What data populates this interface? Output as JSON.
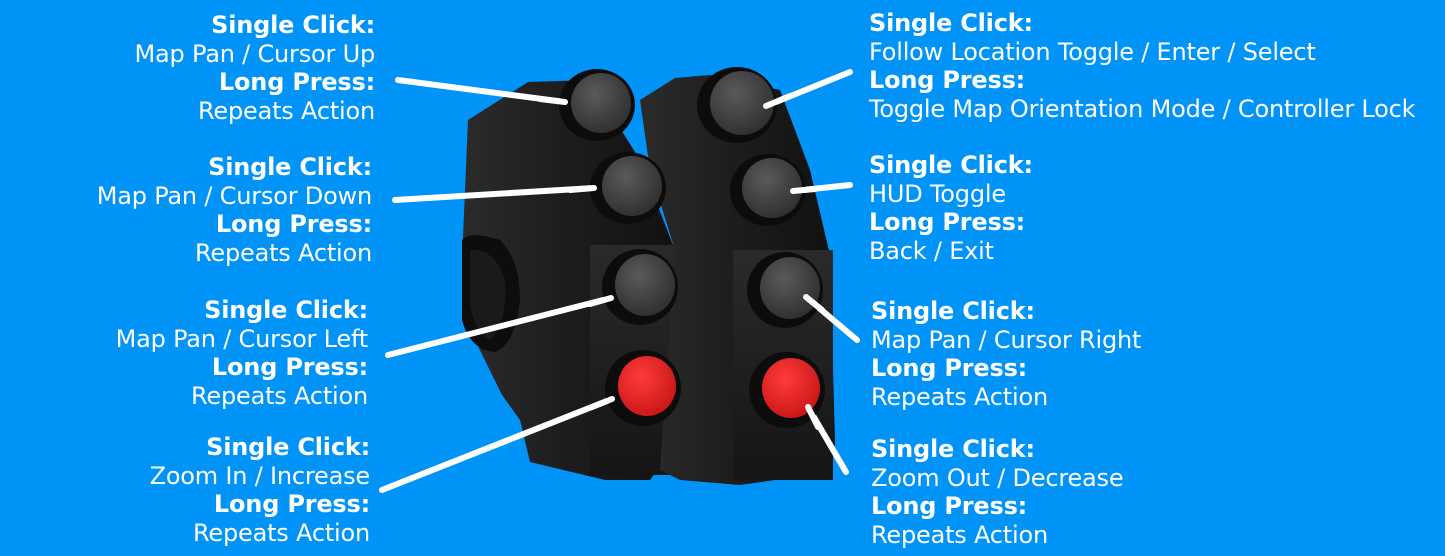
{
  "colors": {
    "background": "#0094f8",
    "text": "#ffffff",
    "leader_line": "#ffffff",
    "button_dark": "#3a3a3a",
    "button_red": "#e21b1b",
    "housing": "#222222"
  },
  "buttons": {
    "left": [
      {
        "id": "left-1",
        "single_click_heading": "Single Click:",
        "single_click_action": "Map Pan / Cursor Up",
        "long_press_heading": "Long Press:",
        "long_press_action": "Repeats Action",
        "cap_color": "dark"
      },
      {
        "id": "left-2",
        "single_click_heading": "Single Click:",
        "single_click_action": "Map Pan / Cursor Down",
        "long_press_heading": "Long Press:",
        "long_press_action": "Repeats Action",
        "cap_color": "dark"
      },
      {
        "id": "left-3",
        "single_click_heading": "Single Click:",
        "single_click_action": "Map Pan / Cursor Left",
        "long_press_heading": "Long Press:",
        "long_press_action": "Repeats Action",
        "cap_color": "dark"
      },
      {
        "id": "left-4",
        "single_click_heading": "Single Click:",
        "single_click_action": "Zoom In / Increase",
        "long_press_heading": "Long Press:",
        "long_press_action": "Repeats Action",
        "cap_color": "red"
      }
    ],
    "right": [
      {
        "id": "right-1",
        "single_click_heading": "Single Click:",
        "single_click_action": "Follow Location Toggle / Enter / Select",
        "long_press_heading": "Long Press:",
        "long_press_action": "Toggle Map Orientation Mode / Controller Lock",
        "cap_color": "dark"
      },
      {
        "id": "right-2",
        "single_click_heading": "Single Click:",
        "single_click_action": "HUD Toggle",
        "long_press_heading": "Long Press:",
        "long_press_action": "Back / Exit",
        "cap_color": "dark"
      },
      {
        "id": "right-3",
        "single_click_heading": "Single Click:",
        "single_click_action": "Map Pan / Cursor Right",
        "long_press_heading": "Long Press:",
        "long_press_action": "Repeats Action",
        "cap_color": "dark"
      },
      {
        "id": "right-4",
        "single_click_heading": "Single Click:",
        "single_click_action": "Zoom Out / Decrease",
        "long_press_heading": "Long Press:",
        "long_press_action": "Repeats Action",
        "cap_color": "red"
      }
    ]
  }
}
